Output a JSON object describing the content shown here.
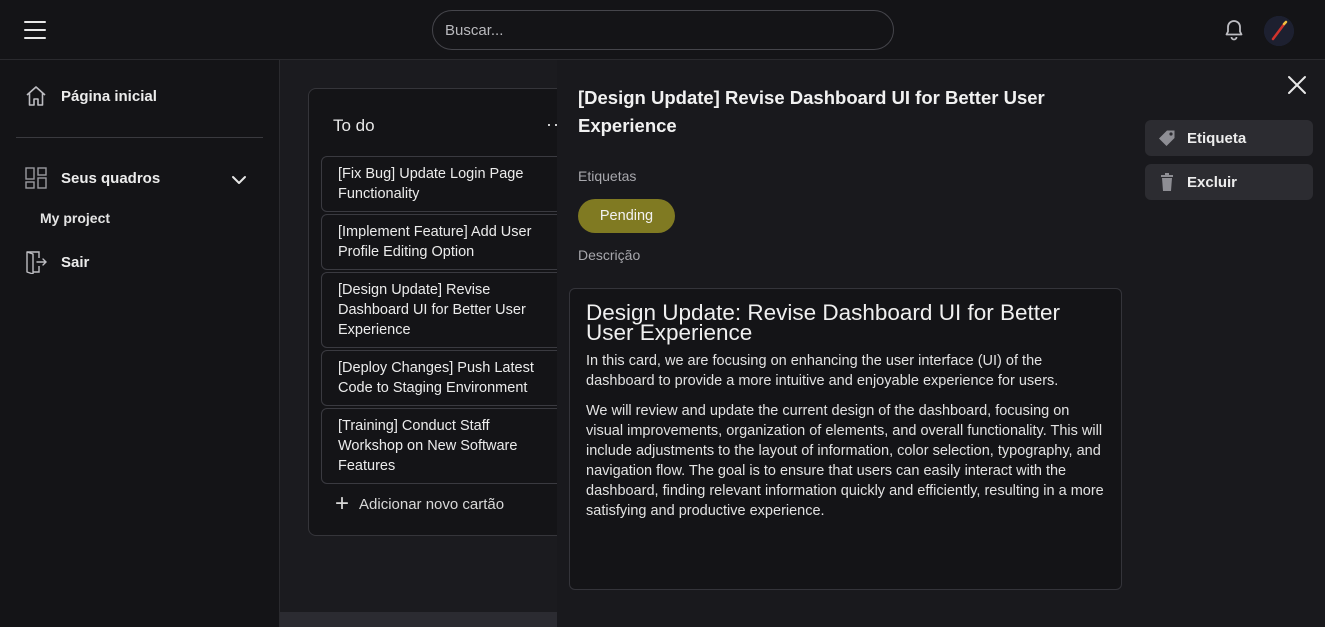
{
  "header": {
    "search_placeholder": "Buscar..."
  },
  "sidebar": {
    "home": "Página inicial",
    "boards": "Seus quadros",
    "board_items": [
      "My project"
    ],
    "logout": "Sair"
  },
  "column": {
    "title": "To do",
    "more": "···",
    "cards": [
      "[Fix Bug] Update Login Page Functionality",
      "[Implement Feature] Add User Profile Editing Option",
      "[Design Update] Revise Dashboard UI for Better User Experience",
      "[Deploy Changes] Push Latest Code to Staging Environment",
      "[Training] Conduct Staff Workshop on New Software Features"
    ],
    "add_card": "Adicionar novo cartão"
  },
  "detail": {
    "title": "[Design Update] Revise Dashboard UI for Better User Experience",
    "tags_label": "Etiquetas",
    "tag": "Pending",
    "description_label": "Descrição",
    "description_heading": "Design Update: Revise Dashboard UI for Better User Experience",
    "description_paragraphs": [
      "In this card, we are focusing on enhancing the user interface (UI) of the dashboard to provide a more intuitive and enjoyable experience for users.",
      "We will review and update the current design of the dashboard, focusing on visual improvements, organization of elements, and overall functionality. This will include adjustments to the layout of information, color selection, typography, and navigation flow. The goal is to ensure that users can easily interact with the dashboard, finding relevant information quickly and efficiently, resulting in a more satisfying and productive experience."
    ],
    "actions": {
      "label": "Etiqueta",
      "delete": "Excluir"
    }
  },
  "colors": {
    "background": "#141417",
    "panel": "#19191d",
    "tag_pending": "#807a22",
    "action_button": "#2c2c31"
  },
  "icons": [
    "menu-icon",
    "bell-icon",
    "home-icon",
    "boards-icon",
    "chevron-down-icon",
    "logout-icon",
    "plus-icon",
    "close-icon",
    "tag-icon",
    "trash-icon"
  ]
}
